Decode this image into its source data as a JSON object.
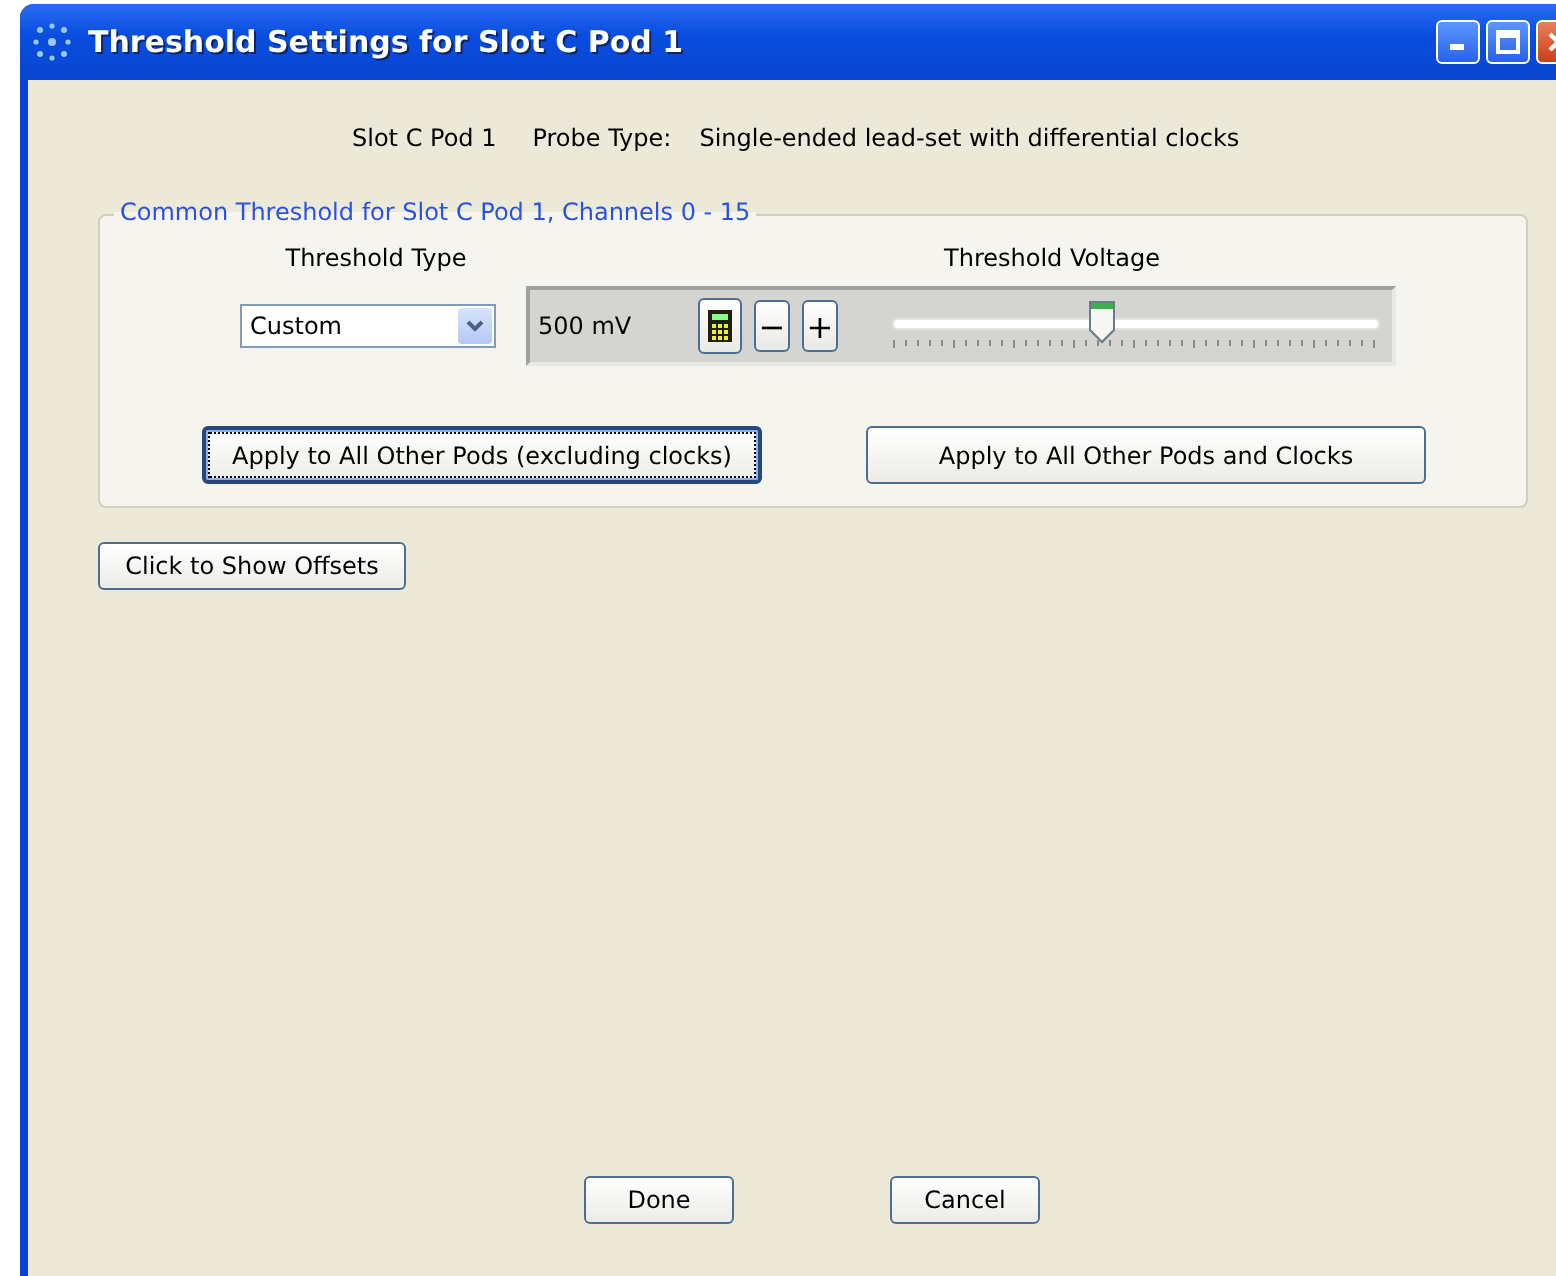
{
  "window": {
    "title": "Threshold Settings for Slot C Pod 1"
  },
  "info": {
    "slot": "Slot C Pod 1",
    "probe_label": "Probe Type:",
    "probe_value": "Single-ended lead-set with differential clocks"
  },
  "threshold": {
    "legend": "Common Threshold for Slot C Pod 1, Channels 0 - 15",
    "type_heading": "Threshold Type",
    "voltage_heading": "Threshold Voltage",
    "type_value": "Custom",
    "voltage_reading": "500 mV",
    "minus": "−",
    "plus": "+",
    "level": 0.43,
    "apply_buttons": [
      {
        "label": "Apply to All Other Pods (excluding clocks)",
        "focused": true
      },
      {
        "label": "Apply to All Other Pods and Clocks",
        "focused": false
      }
    ]
  },
  "offsets_button": "Click to Show Offsets",
  "footer_buttons": [
    "Done",
    "Cancel"
  ]
}
